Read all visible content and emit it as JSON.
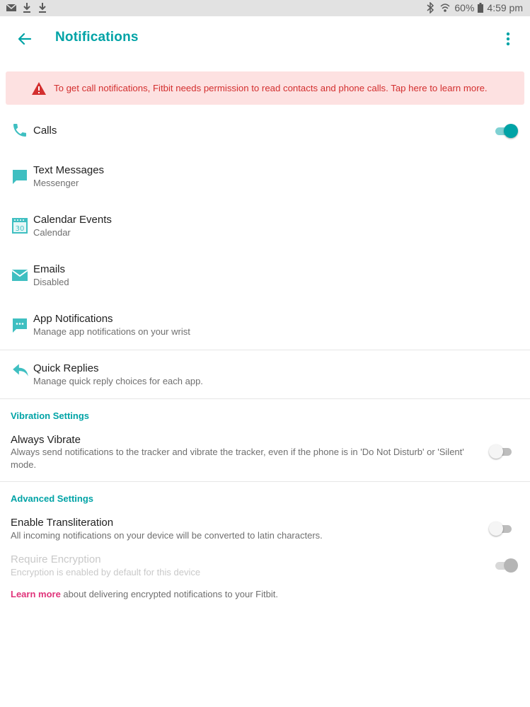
{
  "status_bar": {
    "battery": "60%",
    "time": "4:59 pm"
  },
  "header": {
    "title": "Notifications"
  },
  "banner": {
    "text": "To get call notifications, Fitbit needs permission to read contacts and phone calls. Tap here to learn more."
  },
  "items": [
    {
      "title": "Calls",
      "subtitle": "",
      "icon": "phone-icon",
      "toggle": true
    },
    {
      "title": "Text Messages",
      "subtitle": "Messenger",
      "icon": "message-icon"
    },
    {
      "title": "Calendar Events",
      "subtitle": "Calendar",
      "icon": "calendar-icon"
    },
    {
      "title": "Emails",
      "subtitle": "Disabled",
      "icon": "envelope-icon"
    },
    {
      "title": "App Notifications",
      "subtitle": "Manage app notifications on your wrist",
      "icon": "chat-dots-icon"
    },
    {
      "title": "Quick Replies",
      "subtitle": "Manage quick reply choices for each app.",
      "icon": "reply-icon"
    }
  ],
  "calendar_icon_day": "30",
  "vibration": {
    "header": "Vibration Settings",
    "always_vibrate": {
      "title": "Always Vibrate",
      "description": "Always send notifications to the tracker and vibrate the tracker, even if the phone is in 'Do Not Disturb' or 'Silent' mode.",
      "enabled": false
    }
  },
  "advanced": {
    "header": "Advanced Settings",
    "transliteration": {
      "title": "Enable Transliteration",
      "description": "All incoming notifications on your device will be converted to latin characters.",
      "enabled": false
    },
    "encryption": {
      "title": "Require Encryption",
      "description": "Encryption is enabled by default for this device",
      "enabled": true,
      "disabled": true
    }
  },
  "footer": {
    "link_text": "Learn more",
    "text": " about delivering encrypted notifications to your Fitbit."
  },
  "colors": {
    "accent": "#00a3a6",
    "warning": "#d32f2f",
    "banner_bg": "#fde1e1",
    "link": "#e0337a"
  }
}
